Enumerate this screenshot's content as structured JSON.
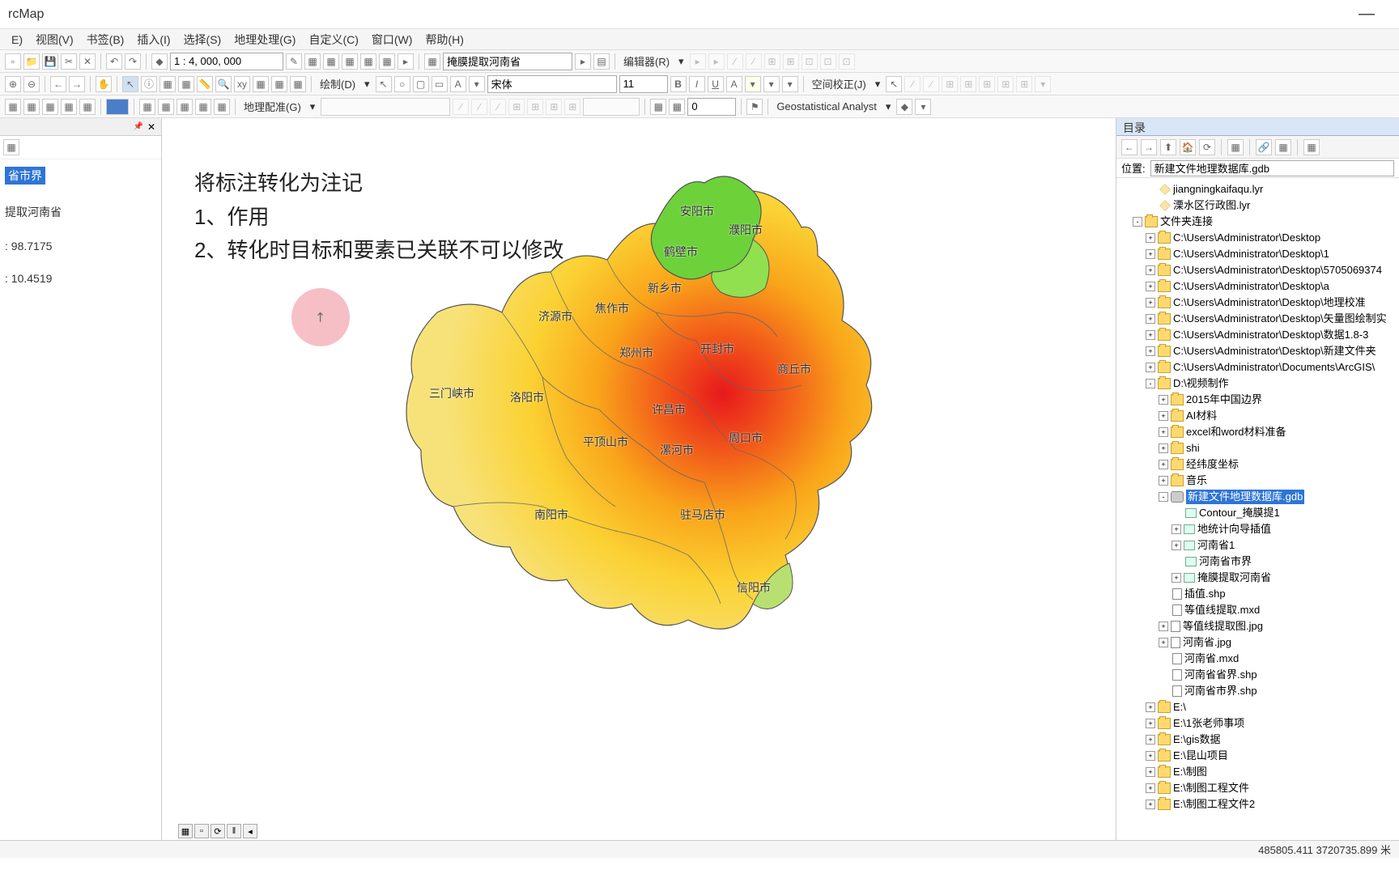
{
  "app": {
    "title": "rcMap"
  },
  "menubar": [
    "E)",
    "视图(V)",
    "书签(B)",
    "插入(I)",
    "选择(S)",
    "地理处理(G)",
    "自定义(C)",
    "窗口(W)",
    "帮助(H)"
  ],
  "toolbar1": {
    "scale": "1 : 4, 000, 000",
    "layer_combo": "掩膜提取河南省",
    "editor_label": "编辑器(R)"
  },
  "toolbar2": {
    "draw_label": "绘制(D)",
    "font": "宋体",
    "size": "11",
    "georef_label": "空间校正(J)"
  },
  "toolbar3": {
    "georeg_label": "地理配准(G)",
    "spin_val": "0",
    "geostat_label": "Geostatistical Analyst"
  },
  "toc": {
    "highlight": "省市界",
    "item2": "提取河南省",
    "stat1_label": ":",
    "stat1_val": "98.7175",
    "stat2_label": ":",
    "stat2_val": "10.4519"
  },
  "annotation": {
    "title": "将标注转化为注记",
    "line1": "1、作用",
    "line2": "2、转化时目标和要素已关联不可以修改"
  },
  "cities": [
    "安阳市",
    "鹤壁市",
    "濮阳市",
    "新乡市",
    "焦作市",
    "济源市",
    "郑州市",
    "开封市",
    "商丘市",
    "洛阳市",
    "三门峡市",
    "许昌市",
    "平顶山市",
    "漯河市",
    "周口市",
    "南阳市",
    "驻马店市",
    "信阳市"
  ],
  "catalog": {
    "title": "目录",
    "location_label": "位置:",
    "location_value": "新建文件地理数据库.gdb",
    "tree": [
      {
        "d": 2,
        "t": "lyr",
        "n": "jiangningkaifaqu.lyr"
      },
      {
        "d": 2,
        "t": "lyr",
        "n": "溧水区行政图.lyr"
      },
      {
        "d": 1,
        "t": "folder",
        "n": "文件夹连接",
        "x": "-"
      },
      {
        "d": 2,
        "t": "folder",
        "n": "C:\\Users\\Administrator\\Desktop",
        "x": "+"
      },
      {
        "d": 2,
        "t": "folder",
        "n": "C:\\Users\\Administrator\\Desktop\\1",
        "x": "+"
      },
      {
        "d": 2,
        "t": "folder",
        "n": "C:\\Users\\Administrator\\Desktop\\5705069374",
        "x": "+"
      },
      {
        "d": 2,
        "t": "folder",
        "n": "C:\\Users\\Administrator\\Desktop\\a",
        "x": "+"
      },
      {
        "d": 2,
        "t": "folder",
        "n": "C:\\Users\\Administrator\\Desktop\\地理校准",
        "x": "+"
      },
      {
        "d": 2,
        "t": "folder",
        "n": "C:\\Users\\Administrator\\Desktop\\矢量图绘制实",
        "x": "+"
      },
      {
        "d": 2,
        "t": "folder",
        "n": "C:\\Users\\Administrator\\Desktop\\数据1.8-3",
        "x": "+"
      },
      {
        "d": 2,
        "t": "folder",
        "n": "C:\\Users\\Administrator\\Desktop\\新建文件夹",
        "x": "+"
      },
      {
        "d": 2,
        "t": "folder",
        "n": "C:\\Users\\Administrator\\Documents\\ArcGIS\\",
        "x": "+"
      },
      {
        "d": 2,
        "t": "folder",
        "n": "D:\\视频制作",
        "x": "-"
      },
      {
        "d": 3,
        "t": "folder",
        "n": "2015年中国边界",
        "x": "+"
      },
      {
        "d": 3,
        "t": "folder",
        "n": "AI材料",
        "x": "+"
      },
      {
        "d": 3,
        "t": "folder",
        "n": "excel和word材料准备",
        "x": "+"
      },
      {
        "d": 3,
        "t": "folder",
        "n": "shi",
        "x": "+"
      },
      {
        "d": 3,
        "t": "folder",
        "n": "经纬度坐标",
        "x": "+"
      },
      {
        "d": 3,
        "t": "folder",
        "n": "音乐",
        "x": "+"
      },
      {
        "d": 3,
        "t": "gdb",
        "n": "新建文件地理数据库.gdb",
        "x": "-",
        "sel": true
      },
      {
        "d": 4,
        "t": "fc",
        "n": "Contour_掩膜提1"
      },
      {
        "d": 4,
        "t": "fc",
        "n": "地统计向导插值",
        "x": "+"
      },
      {
        "d": 4,
        "t": "fc",
        "n": "河南省1",
        "x": "+"
      },
      {
        "d": 4,
        "t": "fc",
        "n": "河南省市界"
      },
      {
        "d": 4,
        "t": "fc",
        "n": "掩膜提取河南省",
        "x": "+"
      },
      {
        "d": 3,
        "t": "file",
        "n": "插值.shp"
      },
      {
        "d": 3,
        "t": "file",
        "n": "等值线提取.mxd"
      },
      {
        "d": 3,
        "t": "file",
        "n": "等值线提取图.jpg",
        "x": "+"
      },
      {
        "d": 3,
        "t": "file",
        "n": "河南省.jpg",
        "x": "+"
      },
      {
        "d": 3,
        "t": "file",
        "n": "河南省.mxd"
      },
      {
        "d": 3,
        "t": "file",
        "n": "河南省省界.shp"
      },
      {
        "d": 3,
        "t": "file",
        "n": "河南省市界.shp"
      },
      {
        "d": 2,
        "t": "folder",
        "n": "E:\\",
        "x": "+"
      },
      {
        "d": 2,
        "t": "folder",
        "n": "E:\\1张老师事项",
        "x": "+"
      },
      {
        "d": 2,
        "t": "folder",
        "n": "E:\\gis数据",
        "x": "+"
      },
      {
        "d": 2,
        "t": "folder",
        "n": "E:\\昆山项目",
        "x": "+"
      },
      {
        "d": 2,
        "t": "folder",
        "n": "E:\\制图",
        "x": "+"
      },
      {
        "d": 2,
        "t": "folder",
        "n": "E:\\制图工程文件",
        "x": "+"
      },
      {
        "d": 2,
        "t": "folder",
        "n": "E:\\制图工程文件2",
        "x": "+"
      }
    ]
  },
  "statusbar": {
    "coords": "485805.411 3720735.899 米"
  }
}
